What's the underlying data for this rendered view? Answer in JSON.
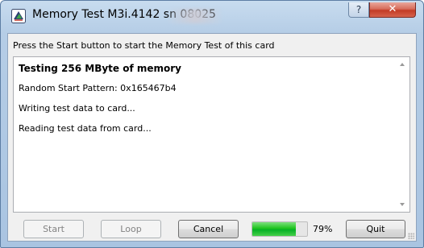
{
  "window": {
    "title": "Memory Test M3i.4142 sn 08025",
    "help_label": "?",
    "close_label": "✕",
    "app_icon": "memory-card-icon"
  },
  "instruction": "Press the Start button to start the Memory Test of this card",
  "log": {
    "lines": [
      "Testing 256 MByte of memory",
      "Random Start Pattern: 0x165467b4",
      "Writing test data to card...",
      "Reading test data from card..."
    ]
  },
  "buttons": {
    "start": "Start",
    "loop": "Loop",
    "cancel": "Cancel",
    "quit": "Quit"
  },
  "progress": {
    "value": 0.79,
    "label": "79%",
    "color": "#06b025"
  }
}
